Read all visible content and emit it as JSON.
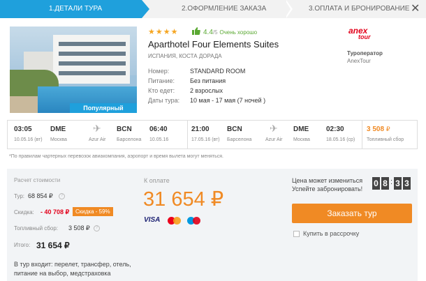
{
  "steps": {
    "step1": "1.ДЕТАЛИ ТУРА",
    "step2": "2.ОФОРМЛЕНИЕ ЗАКАЗА",
    "step3": "3.ОПЛАТА И БРОНИРОВАНИЕ",
    "close": "✕",
    "active_color": "#1fa0dc"
  },
  "hotel": {
    "stars": "★★★★",
    "star_count": 4,
    "rating_value": "4.4",
    "rating_denominator": "/5",
    "rating_text": "Очень хорошо",
    "name": "Aparthotel Four Elements Suites",
    "location": "ИСПАНИЯ, КОСТА ДОРАДА",
    "badge": "Популярный",
    "details": [
      {
        "label": "Номер:",
        "value": "STANDARD ROOM"
      },
      {
        "label": "Питание:",
        "value": "Без питания"
      },
      {
        "label": "Кто едет:",
        "value": "2 взрослых"
      },
      {
        "label": "Даты тура:",
        "value": "10 мая - 17 мая (7 ночей )"
      }
    ]
  },
  "operator": {
    "logo_top": "anex",
    "logo_bottom": "tour",
    "label": "Туроператор",
    "name": "AnexTour"
  },
  "flights": {
    "out": {
      "dep_time": "03:05",
      "dep_date": "10.05.16 (вт)",
      "dep_code": "DME",
      "dep_city": "Москва",
      "airline": "Azur Air",
      "arr_code": "BCN",
      "arr_city": "Барселона",
      "arr_time": "06:40",
      "arr_date": "10.05.16"
    },
    "back": {
      "dep_time": "21:00",
      "dep_date": "17.05.16 (вт)",
      "dep_code": "BCN",
      "dep_city": "Барселона",
      "airline": "Azur Air",
      "arr_code": "DME",
      "arr_city": "Москва",
      "arr_time": "02:30",
      "arr_date": "18.05.16 (ср)"
    },
    "fuel_price": "3 508",
    "fuel_currency": "₽",
    "fuel_label": "Топливный сбор",
    "note": "*По правилам чартерных перевозок авиакомпания, аэропорт и время вылета могут меняться."
  },
  "calc": {
    "title": "Расчет стоимости",
    "tour_label": "Тур:",
    "tour_value": "68 854 ₽",
    "discount_label": "Скидка:",
    "discount_value": "- 40 708 ₽",
    "discount_badge": "Скидка - 59%",
    "fuel_label": "Топливный сбор:",
    "fuel_value": "3 508 ₽",
    "total_label": "Итого:",
    "total_value": "31 654 ₽",
    "includes": "В тур входит: перелет, трансфер, отель, питание на выбор, медстраховка",
    "info_glyph": "?"
  },
  "payment": {
    "title": "К оплате",
    "price": "31 654 ₽",
    "visa": "VISA",
    "mastercard": "MasterCard",
    "maestro": "Maestro",
    "accent_color": "#f08a24"
  },
  "order": {
    "price_change_1": "Цена может измениться",
    "price_change_2": "Успейте забронировать!",
    "timer_digits": [
      "0",
      "8",
      "3",
      "3"
    ],
    "timer_colon": ":",
    "button": "Заказать тур",
    "installment": "Купить в рассрочку"
  }
}
